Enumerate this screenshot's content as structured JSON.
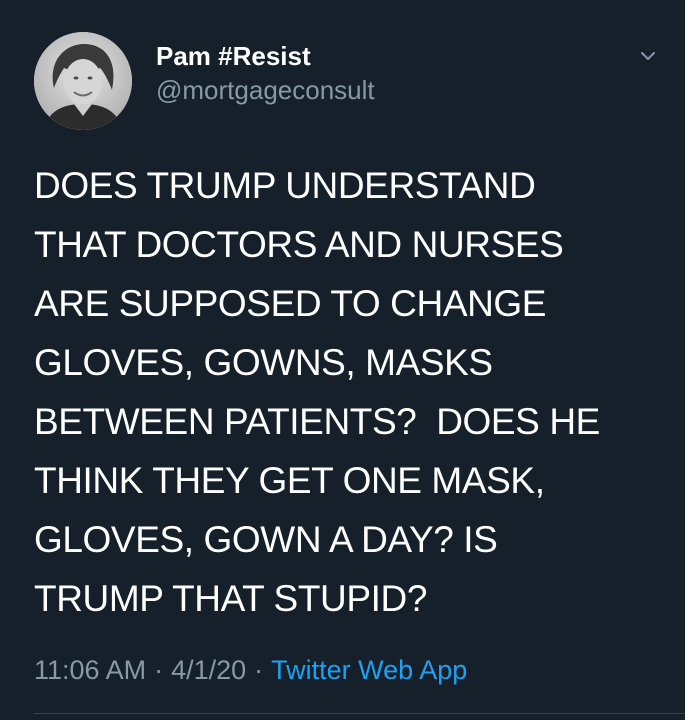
{
  "author": {
    "display_name": "Pam #Resist",
    "handle": "@mortgageconsult",
    "avatar_icon": "user-avatar-photo"
  },
  "menu_icon": "chevron-down-icon",
  "tweet": {
    "lines": [
      "DOES TRUMP UNDERSTAND",
      "THAT DOCTORS AND NURSES",
      "ARE SUPPOSED TO CHANGE",
      "GLOVES, GOWNS, MASKS",
      "BETWEEN PATIENTS?  DOES HE",
      "THINK THEY GET ONE MASK,",
      "GLOVES, GOWN A DAY? IS",
      "TRUMP THAT STUPID?"
    ]
  },
  "meta": {
    "time": "11:06 AM",
    "separator": "·",
    "date": "4/1/20",
    "source": "Twitter Web App"
  },
  "colors": {
    "background": "#15202b",
    "text_primary": "#ffffff",
    "text_secondary": "#8899a6",
    "link": "#1da1f2",
    "divider": "#38444d"
  }
}
